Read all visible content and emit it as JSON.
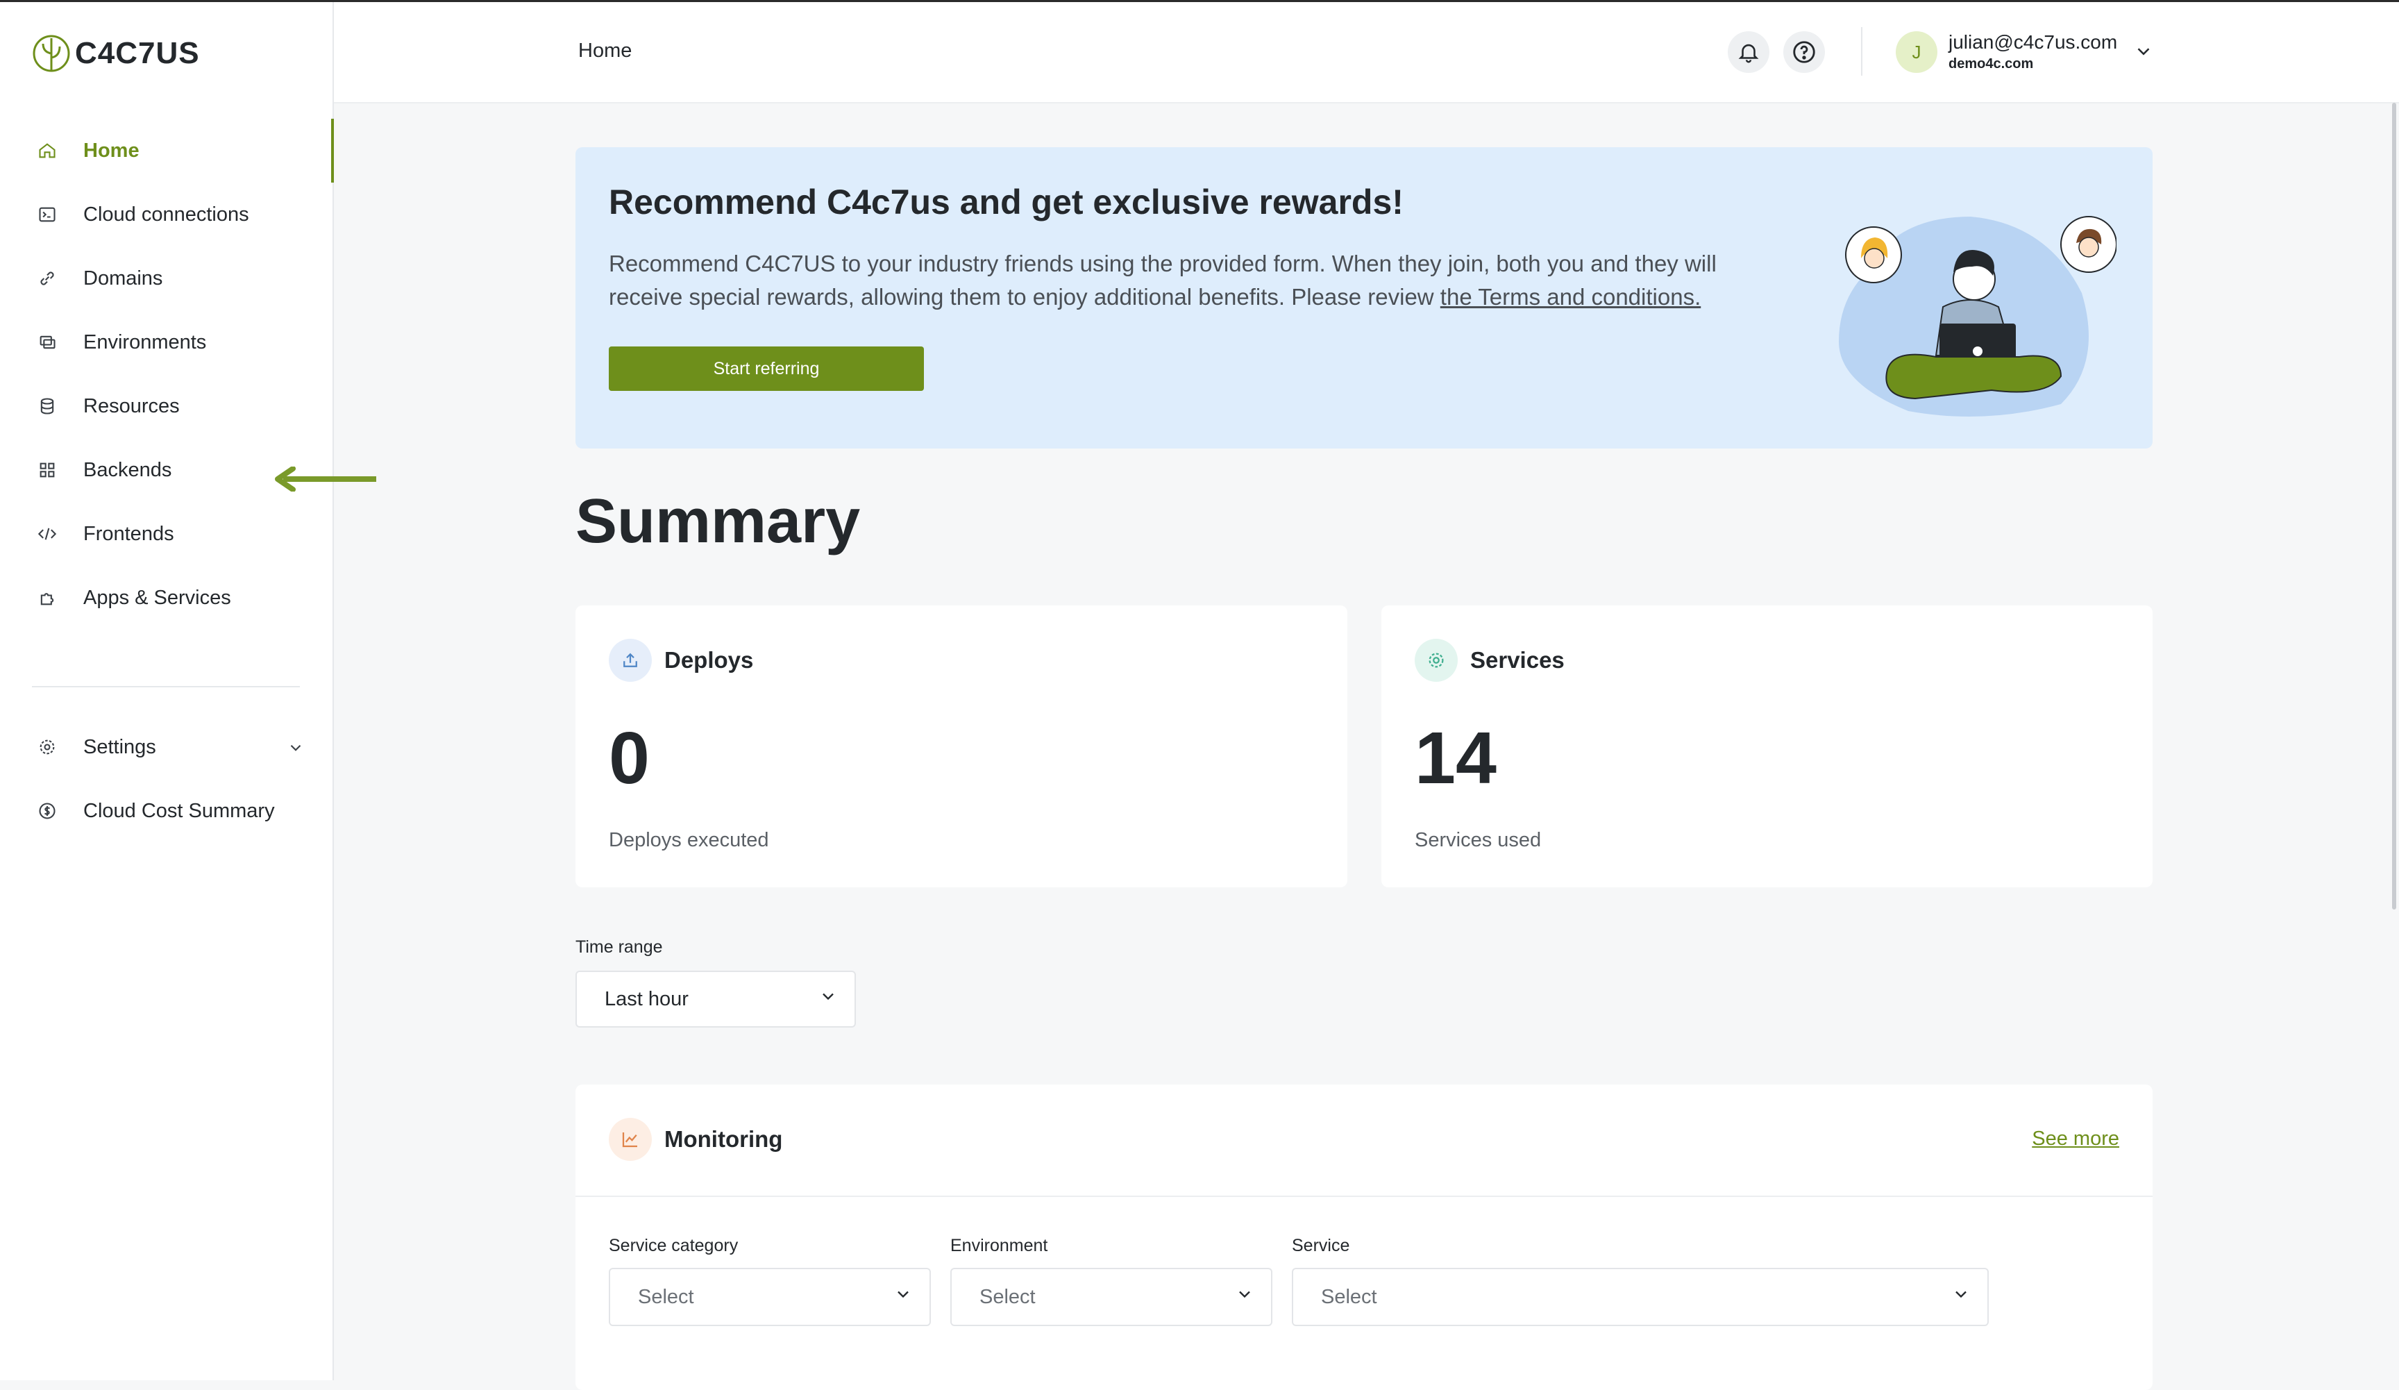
{
  "brand": {
    "name": "C4C7US"
  },
  "sidebar": {
    "items": [
      {
        "label": "Home",
        "icon": "home-icon",
        "active": true
      },
      {
        "label": "Cloud connections",
        "icon": "terminal-icon"
      },
      {
        "label": "Domains",
        "icon": "link-icon"
      },
      {
        "label": "Environments",
        "icon": "environments-icon"
      },
      {
        "label": "Resources",
        "icon": "database-icon"
      },
      {
        "label": "Backends",
        "icon": "grid-icon"
      },
      {
        "label": "Frontends",
        "icon": "code-icon"
      },
      {
        "label": "Apps & Services",
        "icon": "puzzle-icon"
      }
    ],
    "bottom_items": [
      {
        "label": "Settings",
        "icon": "gear-icon",
        "expandable": true
      },
      {
        "label": "Cloud Cost Summary",
        "icon": "dollar-circle-icon"
      }
    ]
  },
  "header": {
    "breadcrumb": "Home",
    "user": {
      "initial": "J",
      "email": "julian@c4c7us.com",
      "org": "demo4c.com"
    }
  },
  "banner": {
    "title": "Recommend C4c7us and get exclusive rewards!",
    "text": "Recommend C4C7US to your industry friends using the provided form. When they join, both you and they will receive special rewards, allowing them to enjoy additional benefits. Please review ",
    "link": "the Terms and conditions.",
    "button": "Start referring"
  },
  "summary": {
    "title": "Summary",
    "cards": [
      {
        "title": "Deploys",
        "value": "0",
        "subtitle": "Deploys executed",
        "icon": "upload-icon"
      },
      {
        "title": "Services",
        "value": "14",
        "subtitle": "Services used",
        "icon": "gear-icon"
      }
    ]
  },
  "time_range": {
    "label": "Time range",
    "value": "Last hour"
  },
  "monitoring": {
    "title": "Monitoring",
    "see_more": "See more",
    "filters": [
      {
        "label": "Service category",
        "placeholder": "Select"
      },
      {
        "label": "Environment",
        "placeholder": "Select"
      },
      {
        "label": "Service",
        "placeholder": "Select"
      }
    ]
  },
  "colors": {
    "accent": "#6e8f1b",
    "banner_bg": "#deedfc",
    "page_bg": "#f6f7f8"
  }
}
